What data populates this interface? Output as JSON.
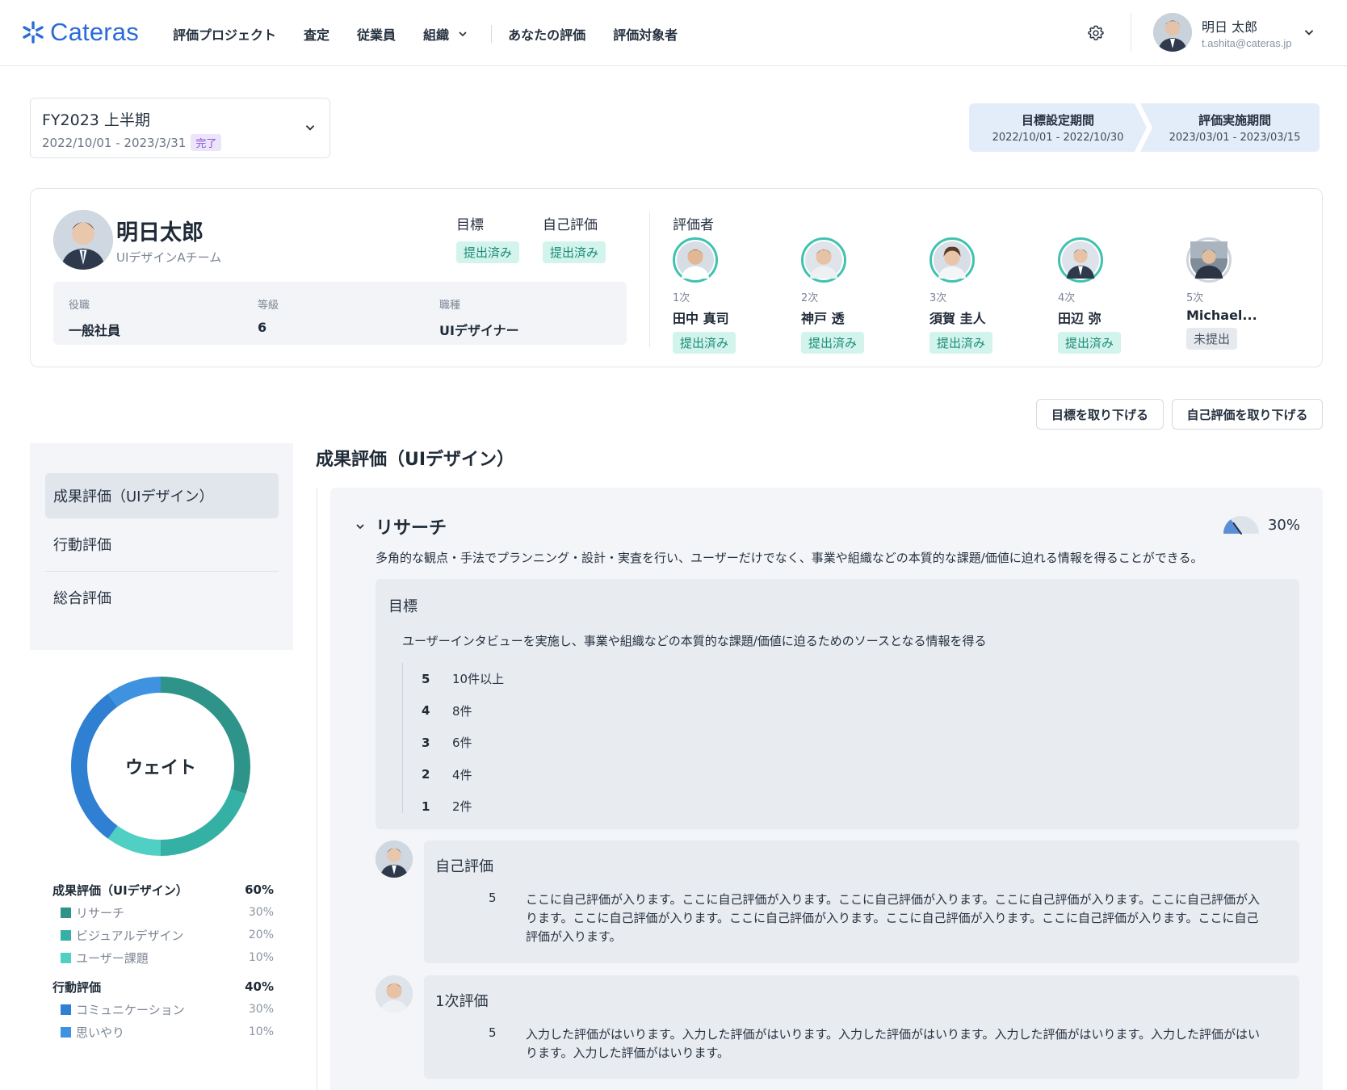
{
  "header": {
    "logo": "Cateras",
    "nav": [
      "評価プロジェクト",
      "査定",
      "従業員",
      "組織",
      "あなたの評価",
      "評価対象者"
    ],
    "user": {
      "name": "明日 太郎",
      "email": "t.ashita@cateras.jp"
    }
  },
  "period": {
    "title": "FY2023 上半期",
    "range": "2022/10/01 - 2023/3/31",
    "status": "完了"
  },
  "steps": [
    {
      "label": "目標設定期間",
      "range": "2022/10/01 - 2022/10/30"
    },
    {
      "label": "評価実施期間",
      "range": "2023/03/01 - 2023/03/15"
    }
  ],
  "employee": {
    "name": "明日太郎",
    "team": "UIデザインAチーム",
    "goal_label": "目標",
    "goal_status": "提出済み",
    "self_label": "自己評価",
    "self_status": "提出済み",
    "info": [
      {
        "key": "役職",
        "value": "一般社員"
      },
      {
        "key": "等級",
        "value": "6"
      },
      {
        "key": "職種",
        "value": "UIデザイナー"
      }
    ]
  },
  "evaluators_title": "評価者",
  "evaluators": [
    {
      "order": "1次",
      "name": "田中 真司",
      "status": "提出済み"
    },
    {
      "order": "2次",
      "name": "神戸 透",
      "status": "提出済み"
    },
    {
      "order": "3次",
      "name": "須賀 圭人",
      "status": "提出済み"
    },
    {
      "order": "4次",
      "name": "田辺 弥",
      "status": "提出済み"
    },
    {
      "order": "5次",
      "name": "Michael...",
      "status": "未提出"
    }
  ],
  "actions": {
    "withdraw_goal": "目標を取り下げる",
    "withdraw_self": "自己評価を取り下げる"
  },
  "sidebar": {
    "items": [
      "成果評価（UIデザイン）",
      "行動評価",
      "総合評価"
    ],
    "active": 0
  },
  "weight": {
    "center_label": "ウェイト",
    "groups": [
      {
        "name": "成果評価（UIデザイン）",
        "pct": "60%",
        "items": [
          {
            "name": "リサーチ",
            "pct": "30%",
            "color": "#2e9389"
          },
          {
            "name": "ビジュアルデザイン",
            "pct": "20%",
            "color": "#34b0a5"
          },
          {
            "name": "ユーザー課題",
            "pct": "10%",
            "color": "#4fd0c2"
          }
        ]
      },
      {
        "name": "行動評価",
        "pct": "40%",
        "items": [
          {
            "name": "コミュニケーション",
            "pct": "30%",
            "color": "#2f7fd2"
          },
          {
            "name": "思いやり",
            "pct": "10%",
            "color": "#3f92e0"
          }
        ]
      }
    ]
  },
  "main": {
    "title": "成果評価（UIデザイン）",
    "section": {
      "title": "リサーチ",
      "weight": "30%",
      "weight_fraction": 0.3,
      "description": "多角的な観点・手法でプランニング・設計・実査を行い、ユーザーだけでなく、事業や組織などの本質的な課題/価値に迫れる情報を得ることができる。",
      "goal": {
        "label": "目標",
        "text": "ユーザーインタビューを実施し、事業や組織などの本質的な課題/価値に迫るためのソースとなる情報を得る",
        "scale": [
          {
            "score": "5",
            "text": "10件以上"
          },
          {
            "score": "4",
            "text": "8件"
          },
          {
            "score": "3",
            "text": "6件"
          },
          {
            "score": "2",
            "text": "4件"
          },
          {
            "score": "1",
            "text": "2件"
          }
        ]
      },
      "comments": [
        {
          "label": "自己評価",
          "score": "5",
          "text": "ここに自己評価が入ります。ここに自己評価が入ります。ここに自己評価が入ります。ここに自己評価が入ります。ここに自己評価が入ります。ここに自己評価が入ります。ここに自己評価が入ります。ここに自己評価が入ります。ここに自己評価が入ります。ここに自己評価が入ります。"
        },
        {
          "label": "1次評価",
          "score": "5",
          "text": "入力した評価がはいります。入力した評価がはいります。入力した評価がはいります。入力した評価がはいります。入力した評価がはいります。入力した評価がはいります。"
        }
      ]
    }
  },
  "colors": {
    "accent": "#2a6bd8",
    "teal": "#3fc2b0",
    "bg_panel": "#f3f5f8"
  },
  "icons": [
    "logo-icon",
    "chevron-down-icon",
    "gear-icon",
    "pie-icon"
  ]
}
